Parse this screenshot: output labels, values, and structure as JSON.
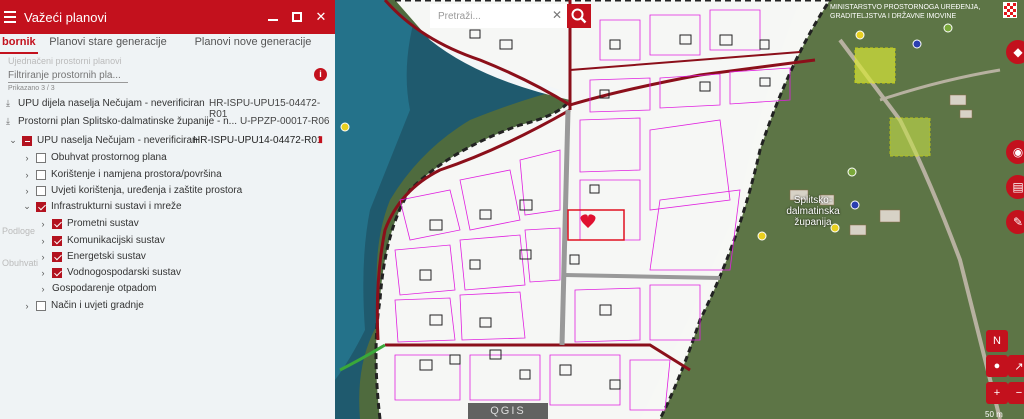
{
  "panel": {
    "title": "Važeći planovi",
    "tabs": [
      {
        "label": "bornik",
        "active": true
      },
      {
        "label": "Planovi stare generacije",
        "active": false
      },
      {
        "label": "Planovi nove generacije",
        "active": false
      }
    ],
    "ghost_heading": "Ujednačeni prostorni planovi",
    "filter_placeholder": "Filtriranje prostornih pla...",
    "filter_count": "Prikazano 3 / 3",
    "plans": [
      {
        "name": "UPU dijela naselja Nečujam - neverificiran",
        "code": "HR-ISPU-UPU15-04472-R01"
      },
      {
        "name": "Prostorni plan Splitsko-dalmatinske županije - n...",
        "code": "U-PPZP-00017-R06"
      },
      {
        "name": "UPU naselja Nečujam - neverificiran",
        "code": "HR-ISPU-UPU14-04472-R01"
      }
    ],
    "layers": [
      {
        "label": "Obuhvat prostornog plana",
        "checked": false
      },
      {
        "label": "Korištenje i namjena prostora/površina",
        "checked": false
      },
      {
        "label": "Uvjeti korištenja, uređenja i zaštite prostora",
        "checked": false
      },
      {
        "label": "Infrastrukturni sustavi i mreže",
        "checked": true
      },
      {
        "label": "Prometni sustav",
        "checked": true
      },
      {
        "label": "Komunikacijski sustav",
        "checked": true
      },
      {
        "label": "Energetski sustav",
        "checked": true
      },
      {
        "label": "Vodnogospodarski sustav",
        "checked": true
      },
      {
        "label": "Gospodarenje otpadom",
        "checked": false
      },
      {
        "label": "Način i uvjeti gradnje",
        "checked": false
      }
    ],
    "ghost_labels": [
      "Podloge",
      "Obuhvati"
    ]
  },
  "search": {
    "placeholder": "Pretraži..."
  },
  "ministry": "MINISTARSTVO PROSTORNOGA UREĐENJA, GRADITELJSTVA I DRŽAVNE IMOVINE",
  "place_label": "Splitsko-dalmatinska županija",
  "scale": "50 m",
  "watermark": "QGIS",
  "compass": "N",
  "zoom_in": "+",
  "zoom_out": "−",
  "colors": {
    "accent": "#c3111d",
    "parcel": "#e020e0",
    "road": "#8b0f1a"
  },
  "icons": [
    "menu-icon",
    "minimize-icon",
    "maximize-icon",
    "close-icon",
    "download-icon",
    "pdf-icon",
    "info-icon",
    "search-icon",
    "layers-icon",
    "location-icon",
    "compass-icon"
  ]
}
